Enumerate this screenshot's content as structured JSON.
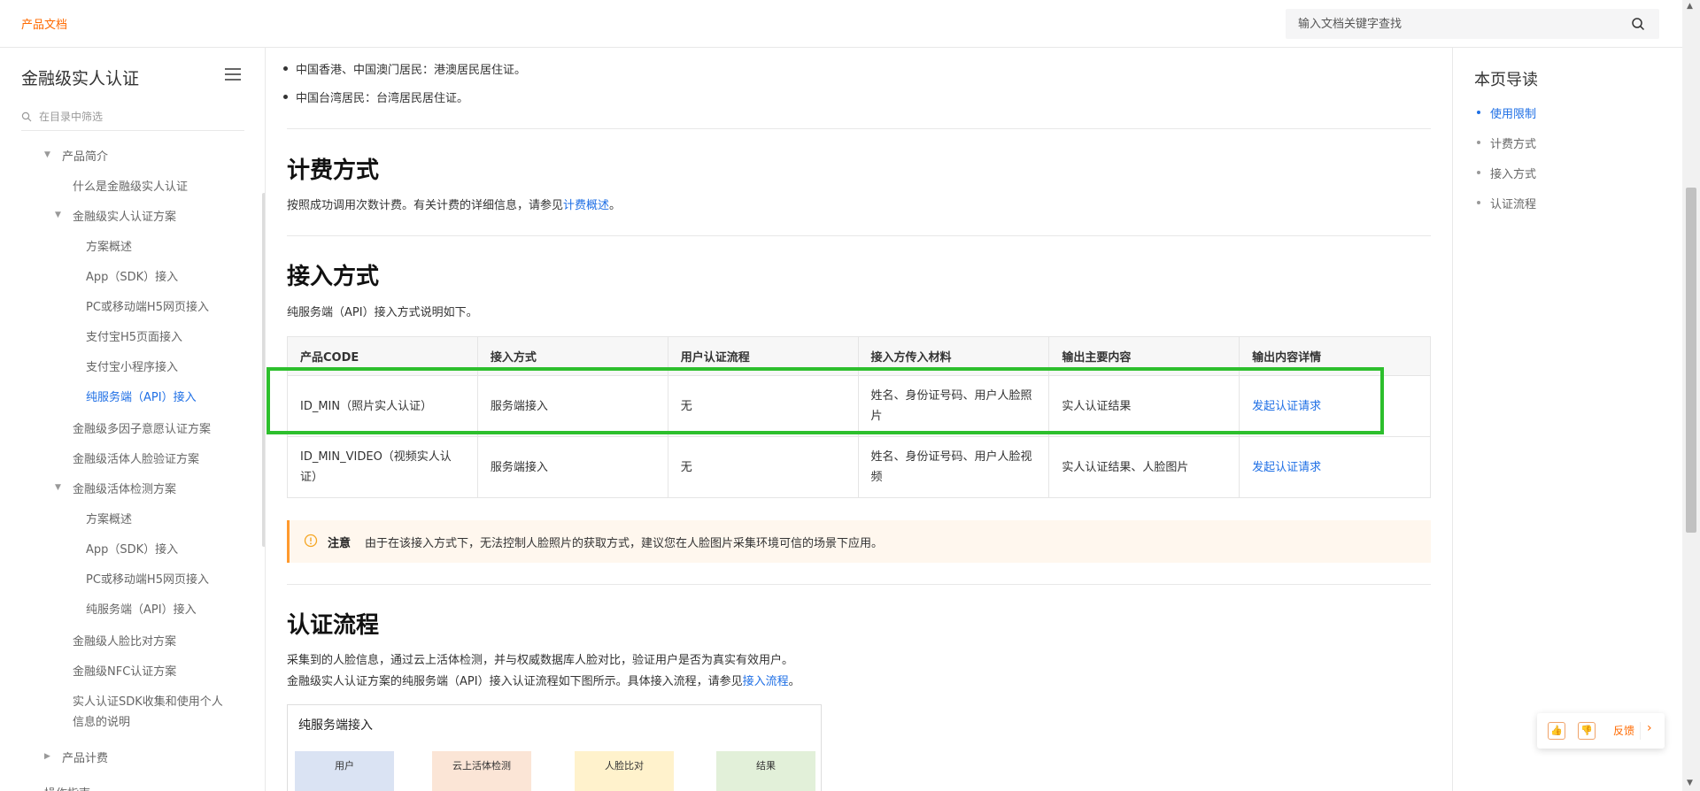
{
  "header": {
    "brand": "产品文档",
    "search_placeholder": "输入文档关键字查找"
  },
  "sidebar": {
    "title": "金融级实人认证",
    "filter_placeholder": "在目录中筛选",
    "items": [
      {
        "label": "产品简介",
        "expanded": true
      },
      {
        "label": "什么是金融级实人认证"
      },
      {
        "label": "金融级实人认证方案",
        "expanded": true
      },
      {
        "label": "方案概述"
      },
      {
        "label": "App（SDK）接入"
      },
      {
        "label": "PC或移动端H5网页接入"
      },
      {
        "label": "支付宝H5页面接入"
      },
      {
        "label": "支付宝小程序接入"
      },
      {
        "label": "纯服务端（API）接入",
        "active": true
      },
      {
        "label": "金融级多因子意愿认证方案"
      },
      {
        "label": "金融级活体人脸验证方案"
      },
      {
        "label": "金融级活体检测方案",
        "expanded": true
      },
      {
        "label": "方案概述"
      },
      {
        "label": "App（SDK）接入"
      },
      {
        "label": "PC或移动端H5网页接入"
      },
      {
        "label": "纯服务端（API）接入"
      },
      {
        "label": "金融级人脸比对方案"
      },
      {
        "label": "金融级NFC认证方案"
      },
      {
        "label": "实人认证SDK收集和使用个人"
      },
      {
        "label": "信息的说明"
      },
      {
        "label": "产品计费",
        "expanded": false
      },
      {
        "label": "操作指南"
      }
    ]
  },
  "main": {
    "bullets": [
      "中国香港、中国澳门居民：港澳居民居住证。",
      "中国台湾居民：台湾居民居住证。"
    ],
    "billing": {
      "heading": "计费方式",
      "text": "按照成功调用次数计费。有关计费的详细信息，请参见",
      "link": "计费概述",
      "end": "。"
    },
    "access": {
      "heading": "接入方式",
      "text": "纯服务端（API）接入方式说明如下。",
      "table": {
        "headers": [
          "产品CODE",
          "接入方式",
          "用户认证流程",
          "接入方传入材料",
          "输出主要内容",
          "输出内容详情"
        ],
        "rows": [
          [
            "ID_MIN（照片实人认证）",
            "服务端接入",
            "无",
            "姓名、身份证号码、用户人脸照片",
            "实人认证结果",
            "发起认证请求"
          ],
          [
            "ID_MIN_VIDEO（视频实人认证）",
            "服务端接入",
            "无",
            "姓名、身份证号码、用户人脸视频",
            "实人认证结果、人脸图片",
            "发起认证请求"
          ]
        ]
      },
      "note_title": "注意",
      "note_text": "由于在该接入方式下，无法控制人脸照片的获取方式，建议您在人脸图片采集环境可信的场景下应用。"
    },
    "flow": {
      "heading": "认证流程",
      "line1": "采集到的人脸信息，通过云上活体检测，并与权威数据库人脸对比，验证用户是否为真实有效用户。",
      "line2": "金融级实人认证方案的纯服务端（API）接入认证流程如下图所示。具体接入流程，请参见",
      "line2_link": "接入流程",
      "line2_end": "。",
      "diagram": {
        "title": "纯服务端接入",
        "boxes": [
          {
            "label": "用户",
            "color": "#dae3f3"
          },
          {
            "label": "云上活体检测",
            "color": "#fbe5d6"
          },
          {
            "label": "人脸比对",
            "color": "#fff2cc"
          },
          {
            "label": "结果",
            "color": "#e2f0d9"
          }
        ]
      }
    }
  },
  "toc": {
    "title": "本页导读",
    "items": [
      {
        "label": "使用限制",
        "active": true
      },
      {
        "label": "计费方式"
      },
      {
        "label": "接入方式"
      },
      {
        "label": "认证流程"
      }
    ]
  },
  "feedback": {
    "like": "👍",
    "dislike": "👎",
    "label": "反馈",
    "arrow": "›"
  },
  "colors": {
    "accent": "#ff6a00",
    "link": "#1f6fe5",
    "highlight": "#2dbf2d"
  }
}
